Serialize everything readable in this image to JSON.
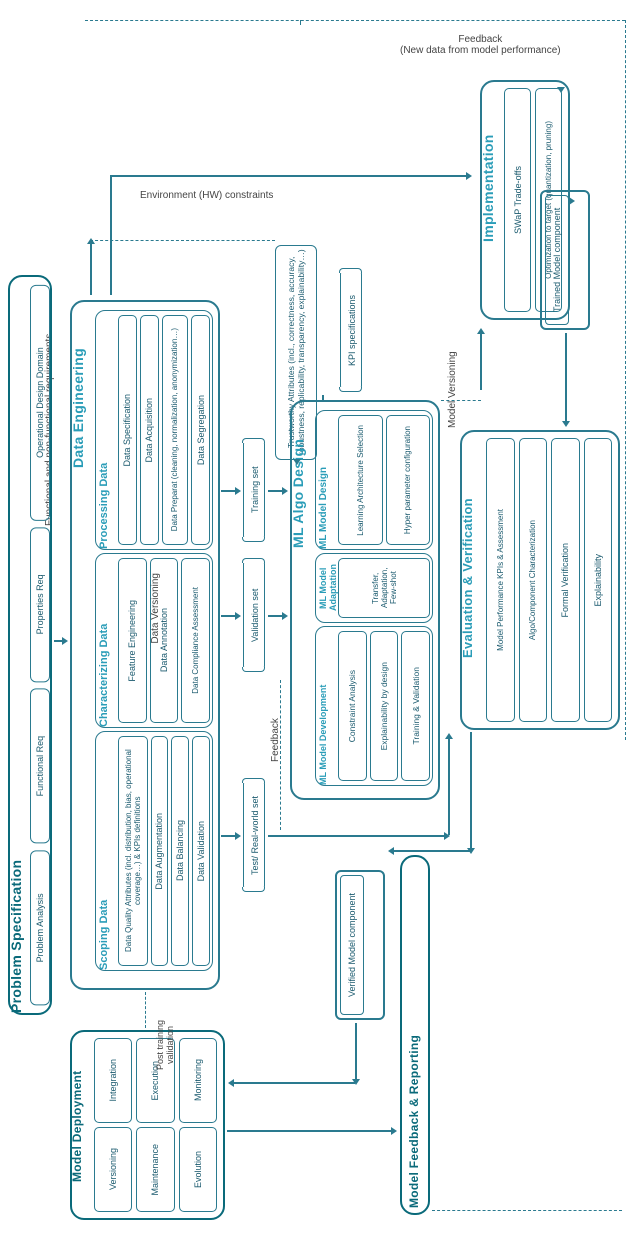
{
  "labels": {
    "feedback_top": "Feedback",
    "feedback_top2": "(New data from model performance)",
    "env_constraints": "Environment (HW) constraints",
    "func_req": "Functional and non-functional requirements",
    "data_versioning": "Data Versioning",
    "model_versioning": "Model Versioning",
    "feedback_mid": "Feedback",
    "post_training": "Post training validation"
  },
  "problem_spec": {
    "title": "Problem Specification",
    "items": [
      "Operational Design Domain",
      "Properties Req",
      "Functional Req",
      "Problem Analysis"
    ]
  },
  "data_eng": {
    "title": "Data Engineering",
    "processing": {
      "title": "Processing Data",
      "items": [
        "Data Specification",
        "Data Acquisition",
        "Data Preparat (cleaning, normalization, anonymization…)",
        "Data Segregation"
      ]
    },
    "characterizing": {
      "title": "Characterizing Data",
      "items": [
        "Feature Engineering",
        "Data Annotation",
        "Data Compliance Assessment"
      ]
    },
    "scoping": {
      "title": "Scoping Data",
      "items": [
        "Data Quality Attributes (incl. distribution, bias, operational coverage…) & KPIs definitions",
        "Data Augmentation",
        "Data Balancing",
        "Data Validation"
      ]
    }
  },
  "datasets": {
    "training": "Training set",
    "validation": "Validation set",
    "test": "Test/ Real-world set"
  },
  "trustworthy": "Trustworthy Attributes (incl., correctness, accuracy, robustness, replicability, transparency, explainability…)",
  "kpi": "KPI specifications",
  "ml_algo": {
    "title": "ML Algo Design",
    "model_design": {
      "title": "ML Model Design",
      "items": [
        "Learning Architecture Selection",
        "Hyper parameter configuration"
      ]
    },
    "model_adapt": {
      "title": "ML Model Adaptation",
      "items": [
        "Transfer, Adaptation, Few-shot"
      ]
    },
    "model_dev": {
      "title": "ML Model Development",
      "items": [
        "Constraint Analysis",
        "Explainability by design",
        "Training & Validation"
      ]
    }
  },
  "implementation": {
    "title": "Implementation",
    "items": [
      "SWaP Trade-offs",
      "Optimization to target (quantization, pruning)"
    ]
  },
  "trained_model": "Trained Model component",
  "evaluation": {
    "title": "Evaluation & Verification",
    "items": [
      "Model Performance KPIs & Assessment",
      "Algo/Component Characterization",
      "Formal Verification",
      "Explainability"
    ]
  },
  "verified_model": "Verified Model component",
  "deployment": {
    "title": "Model Deployment",
    "row1": [
      "Integration",
      "Versioning"
    ],
    "row2": [
      "Execution",
      "Maintenance"
    ],
    "row3": [
      "Monitoring",
      "Evolution"
    ]
  },
  "feedback_reporting": "Model Feedback & Reporting"
}
